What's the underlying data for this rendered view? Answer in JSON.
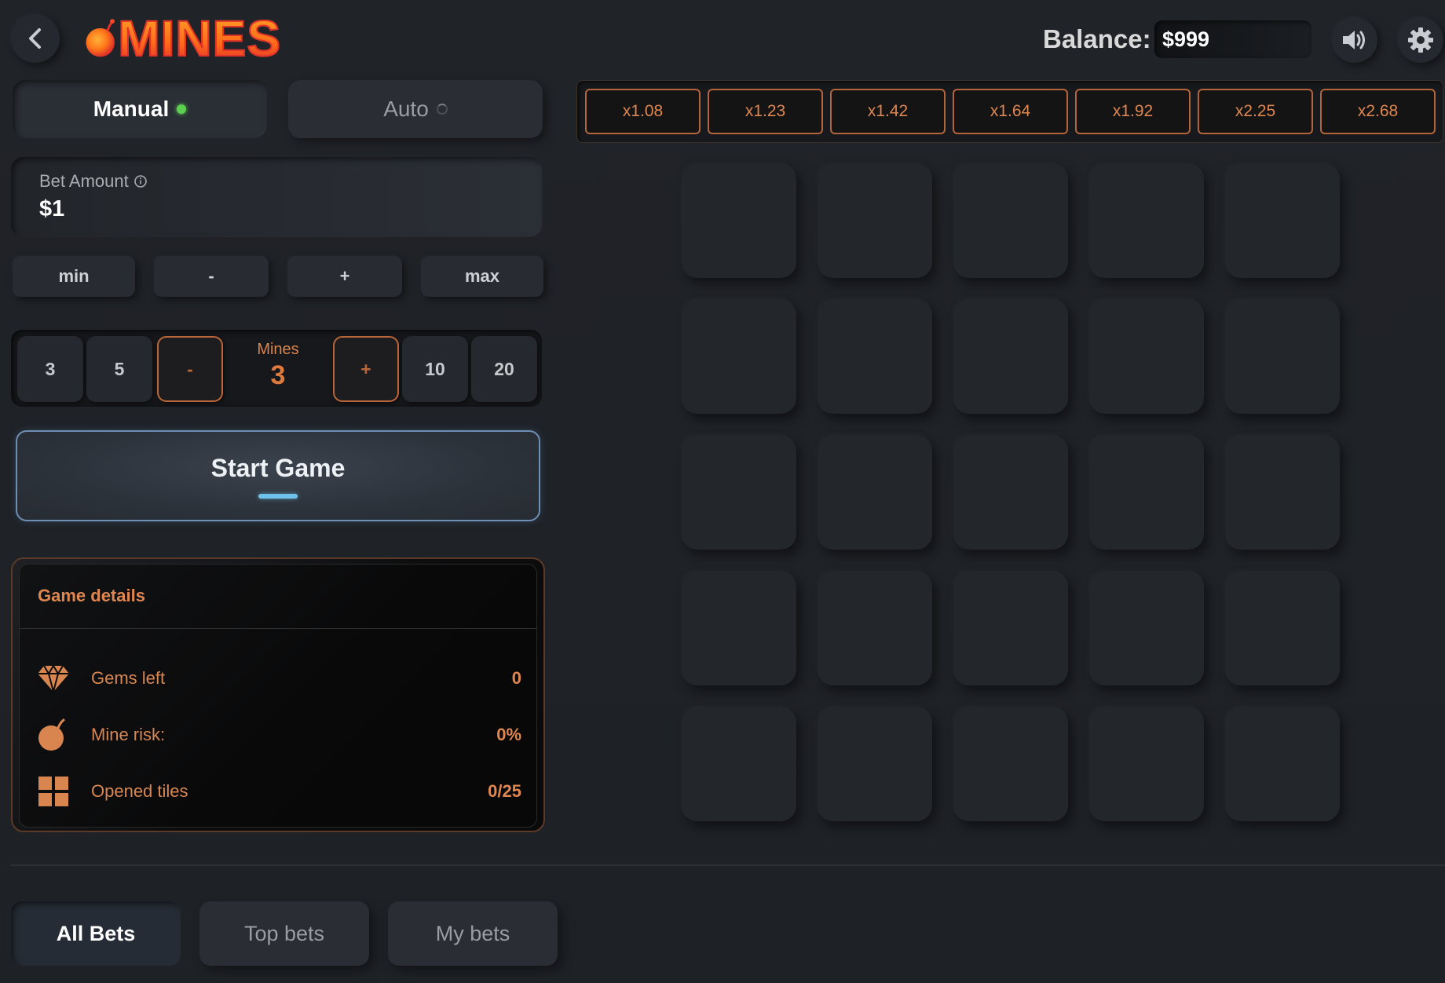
{
  "header": {
    "logo_text": "MINES",
    "balance_label": "Balance:",
    "balance_value": "$999"
  },
  "modes": {
    "manual_label": "Manual",
    "auto_label": "Auto"
  },
  "bet": {
    "label": "Bet Amount",
    "value": "$1",
    "min_label": "min",
    "minus_label": "-",
    "plus_label": "+",
    "max_label": "max"
  },
  "mines": {
    "presets": [
      "3",
      "5",
      "10",
      "20"
    ],
    "minus_label": "-",
    "plus_label": "+",
    "label": "Mines",
    "value": "3"
  },
  "start_button_label": "Start Game",
  "details": {
    "title": "Game details",
    "rows": [
      {
        "icon": "diamond-icon",
        "label": "Gems left",
        "value": "0"
      },
      {
        "icon": "bomb-icon",
        "label": "Mine risk:",
        "value": "0%"
      },
      {
        "icon": "grid-icon",
        "label": "Opened tiles",
        "value": "0/25"
      }
    ]
  },
  "multipliers": [
    "x1.08",
    "x1.23",
    "x1.42",
    "x1.64",
    "x1.92",
    "x2.25",
    "x2.68"
  ],
  "board": {
    "rows": 5,
    "cols": 5
  },
  "bets_tabs": [
    "All Bets",
    "Top bets",
    "My bets"
  ],
  "colors": {
    "accent_orange": "#e08650",
    "active_green": "#5ccf4f",
    "start_glow": "#6fc2ea"
  }
}
